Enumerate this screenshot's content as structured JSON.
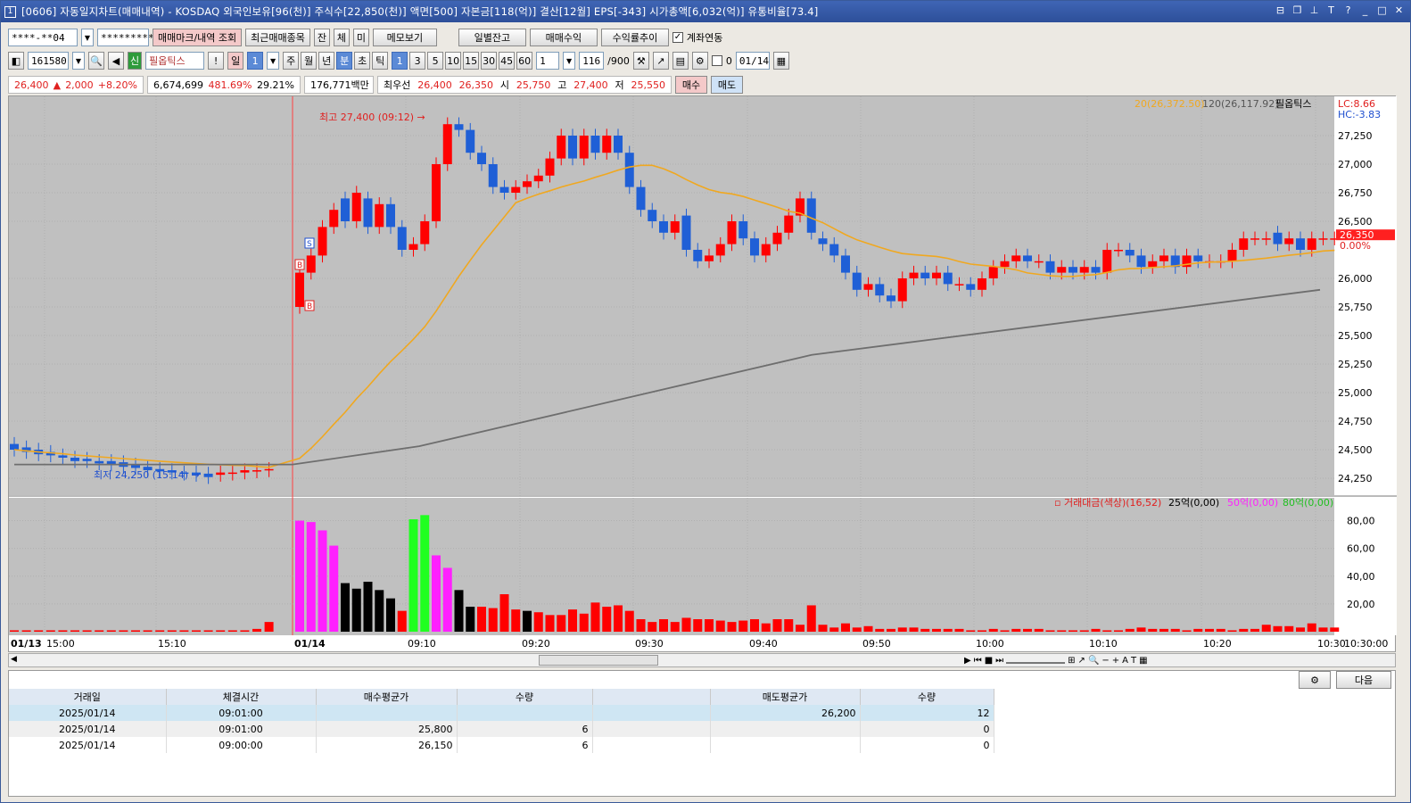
{
  "window": {
    "title": "[0606] 자동일지차트(매매내역) - KOSDAQ 외국인보유[96(천)] 주식수[22,850(천)] 액면[500] 자본금[118(억)] 결산[12월] EPS[-343] 시가총액[6,032(억)] 유통비율[73.4]",
    "app_icon": "1"
  },
  "toolbar1": {
    "account": "****-**04",
    "password": "*********",
    "btn_markers": "매매마크/내역 조회",
    "btn_recent": "최근매매종목",
    "btn_jan": "잔",
    "btn_che": "체",
    "btn_mi": "미",
    "btn_memo": "메모보기",
    "btn_daily_balance": "일별잔고",
    "btn_trade_profit": "매매수익",
    "btn_return_trend": "수익률추이",
    "link_label": "계좌연동",
    "link_checked": true
  },
  "toolbar2": {
    "code": "161580",
    "badge_sin": "신",
    "stock_name": "필옵틱스",
    "period_day": "일",
    "period_num": "1",
    "periods": [
      "주",
      "월",
      "년",
      "분",
      "초",
      "틱"
    ],
    "active_period": "분",
    "intervals": [
      "1",
      "3",
      "5",
      "10",
      "15",
      "30",
      "45",
      "60"
    ],
    "interval_input": "1",
    "count": "116",
    "count_max": "/900",
    "date_label": "0",
    "date": "01/14"
  },
  "quote": {
    "price": "26,400",
    "arrow": "▲",
    "change": "2,000",
    "change_pct": "+8.20%",
    "volume": "6,674,699",
    "vol_ratio": "481.69%",
    "turnover": "29.21%",
    "amount": "176,771백만",
    "best_label": "최우선",
    "best_ask": "26,400",
    "best_bid": "26,350",
    "open_label": "시",
    "open": "25,750",
    "high_label": "고",
    "high": "27,400",
    "low_label": "저",
    "low": "25,550",
    "buy_btn": "매수",
    "sell_btn": "매도"
  },
  "chart": {
    "legend_ma20": "20(26,372.50)",
    "legend_ma120": "120(26,117.92)",
    "legend_name": "필옵틱스",
    "lc": "LC:8.66",
    "hc": "HC:-3.83",
    "high_label": "최고 27,400 (09:12)",
    "low_label": "최저 24,250 (15:14)",
    "price_tag": "26,350",
    "pct_tag": "0.00%",
    "price_ticks": [
      "27,250",
      "27,000",
      "26,750",
      "26,500",
      "26,000",
      "25,750",
      "25,500",
      "25,250",
      "25,000",
      "24,750",
      "24,500",
      "24,250"
    ],
    "vol_legend_1": "거래대금(색상)(16,52)",
    "vol_legend_2": "25억(0,00)",
    "vol_legend_3": "50억(0,00)",
    "vol_legend_4": "80억(0,00)",
    "vol_ticks": [
      "80,00",
      "60,00",
      "40,00",
      "20,00"
    ],
    "time_labels": [
      "01/13",
      "15:00",
      "15:10",
      "01/14",
      "09:10",
      "09:20",
      "09:30",
      "09:40",
      "09:50",
      "10:00",
      "10:10",
      "10:20",
      "10:30"
    ],
    "time_corner": "10:30:00",
    "colors": {
      "up": "#ff0000",
      "down": "#1f5fd6",
      "ma20": "#f0a820",
      "ma120": "#6e6e6e",
      "vol_magenta": "#ff20ff",
      "vol_green": "#20ff20",
      "vol_black": "#000000"
    }
  },
  "bottom": {
    "settings_btn": "gear-icon",
    "next_btn": "다음",
    "columns": [
      "거래일",
      "체결시간",
      "매수평균가",
      "수량",
      "",
      "매도평균가",
      "수량"
    ],
    "rows": [
      [
        "2025/01/14",
        "09:01:00",
        "",
        "",
        "",
        "26,200",
        "12"
      ],
      [
        "2025/01/14",
        "09:01:00",
        "25,800",
        "6",
        "",
        "",
        "0"
      ],
      [
        "2025/01/14",
        "09:00:00",
        "26,150",
        "6",
        "",
        "",
        "0"
      ]
    ]
  }
}
